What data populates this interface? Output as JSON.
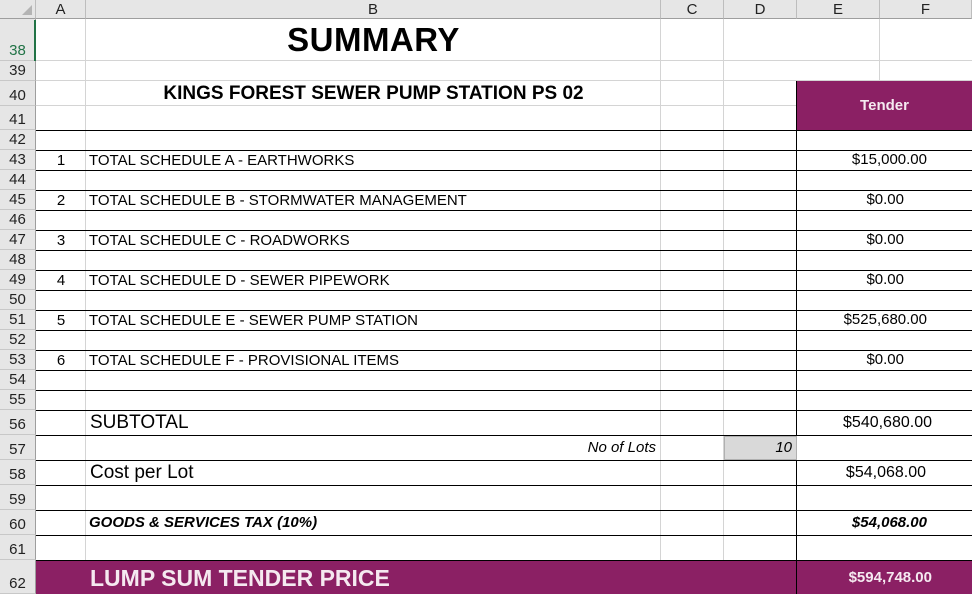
{
  "columns": [
    "A",
    "B",
    "C",
    "D",
    "E",
    "F"
  ],
  "rows": [
    "38",
    "39",
    "40",
    "41",
    "42",
    "43",
    "44",
    "45",
    "46",
    "47",
    "48",
    "49",
    "50",
    "51",
    "52",
    "53",
    "54",
    "55",
    "56",
    "57",
    "58",
    "59",
    "60",
    "61",
    "62"
  ],
  "title": "SUMMARY",
  "subtitle": "KINGS FOREST SEWER PUMP STATION PS 02",
  "tender_header": "Tender",
  "schedules": [
    {
      "no": "1",
      "label": "TOTAL SCHEDULE A - EARTHWORKS",
      "amount": "$15,000.00"
    },
    {
      "no": "2",
      "label": "TOTAL SCHEDULE B - STORMWATER MANAGEMENT",
      "amount": "$0.00"
    },
    {
      "no": "3",
      "label": "TOTAL SCHEDULE C - ROADWORKS",
      "amount": "$0.00"
    },
    {
      "no": "4",
      "label": "TOTAL SCHEDULE D - SEWER PIPEWORK",
      "amount": "$0.00"
    },
    {
      "no": "5",
      "label": "TOTAL SCHEDULE E - SEWER PUMP STATION",
      "amount": "$525,680.00"
    },
    {
      "no": "6",
      "label": "TOTAL SCHEDULE F - PROVISIONAL ITEMS",
      "amount": "$0.00"
    }
  ],
  "subtotal": {
    "label": "SUBTOTAL",
    "amount": "$540,680.00"
  },
  "lots": {
    "label": "No of Lots",
    "value": "10"
  },
  "cost_per_lot": {
    "label": "Cost per Lot",
    "amount": "$54,068.00"
  },
  "gst": {
    "label": "GOODS & SERVICES TAX (10%)",
    "amount": "$54,068.00"
  },
  "lump_sum": {
    "label": "LUMP SUM TENDER PRICE",
    "amount": "$594,748.00"
  },
  "colors": {
    "accent": "#8b2064",
    "selected_row": "#217346"
  }
}
